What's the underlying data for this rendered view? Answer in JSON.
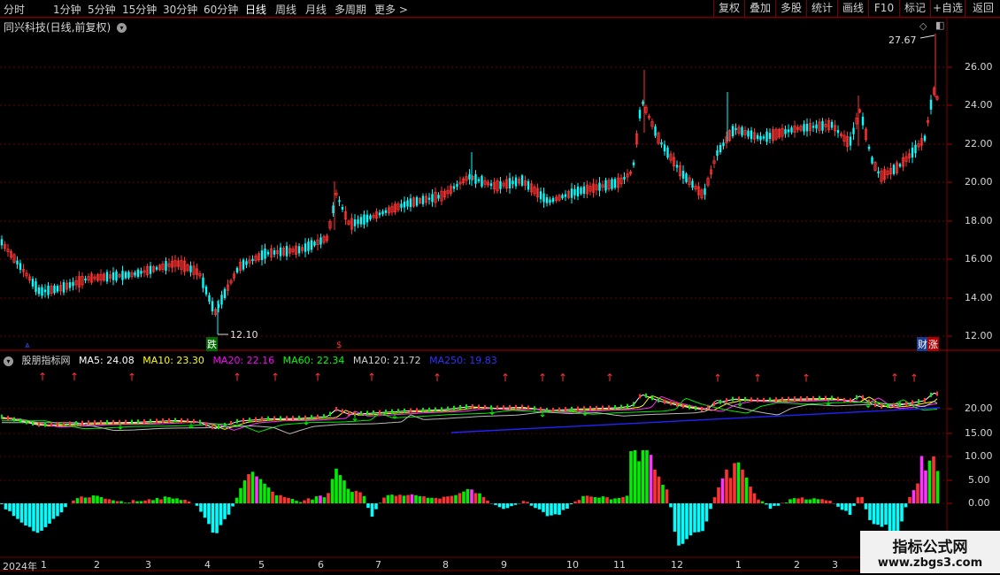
{
  "toolbar": {
    "tabs": [
      "分时",
      "1分钟",
      "5分钟",
      "15分钟",
      "30分钟",
      "60分钟",
      "日线",
      "周线",
      "月线",
      "多周期",
      "更多"
    ],
    "active_tab": "日线",
    "buttons": [
      "复权",
      "叠加",
      "多股",
      "统计",
      "画线",
      "F10",
      "标记",
      "+自选",
      "返回"
    ]
  },
  "chart": {
    "title": "同兴科技(日线,前复权)",
    "price_labels": [
      "26.00",
      "24.00",
      "22.00",
      "20.00",
      "18.00",
      "16.00",
      "14.00",
      "12.00"
    ],
    "high_marker": "27.67",
    "low_marker": "12.10",
    "badge_die": "跌",
    "badge_cai": "财",
    "badge_zhang": "涨"
  },
  "indicator": {
    "name": "股朋指标网",
    "ma": [
      {
        "label": "MA5: 24.08",
        "color": "#ffffff"
      },
      {
        "label": "MA10: 23.30",
        "color": "#ffff00"
      },
      {
        "label": "MA20: 22.16",
        "color": "#ff00ff"
      },
      {
        "label": "MA60: 22.34",
        "color": "#00ff00"
      },
      {
        "label": "MA120: 21.72",
        "color": "#d0d0d0"
      },
      {
        "label": "MA250: 19.83",
        "color": "#3030ff"
      }
    ],
    "upper_labels": [
      "20.00",
      "15.00",
      "10.00"
    ],
    "lower_labels": [
      "10.00",
      "5.00",
      "0.00"
    ]
  },
  "timeline": {
    "year": "2024年",
    "months": [
      "1",
      "2",
      "3",
      "4",
      "5",
      "6",
      "7",
      "8",
      "9",
      "10",
      "11",
      "12",
      "1",
      "2",
      "3"
    ]
  },
  "watermark": {
    "line1": "指标公式网",
    "line2": "www.zbgs3.com"
  },
  "colors": {
    "up": "#ff3232",
    "down": "#00ffff",
    "border": "#7a0000"
  }
}
